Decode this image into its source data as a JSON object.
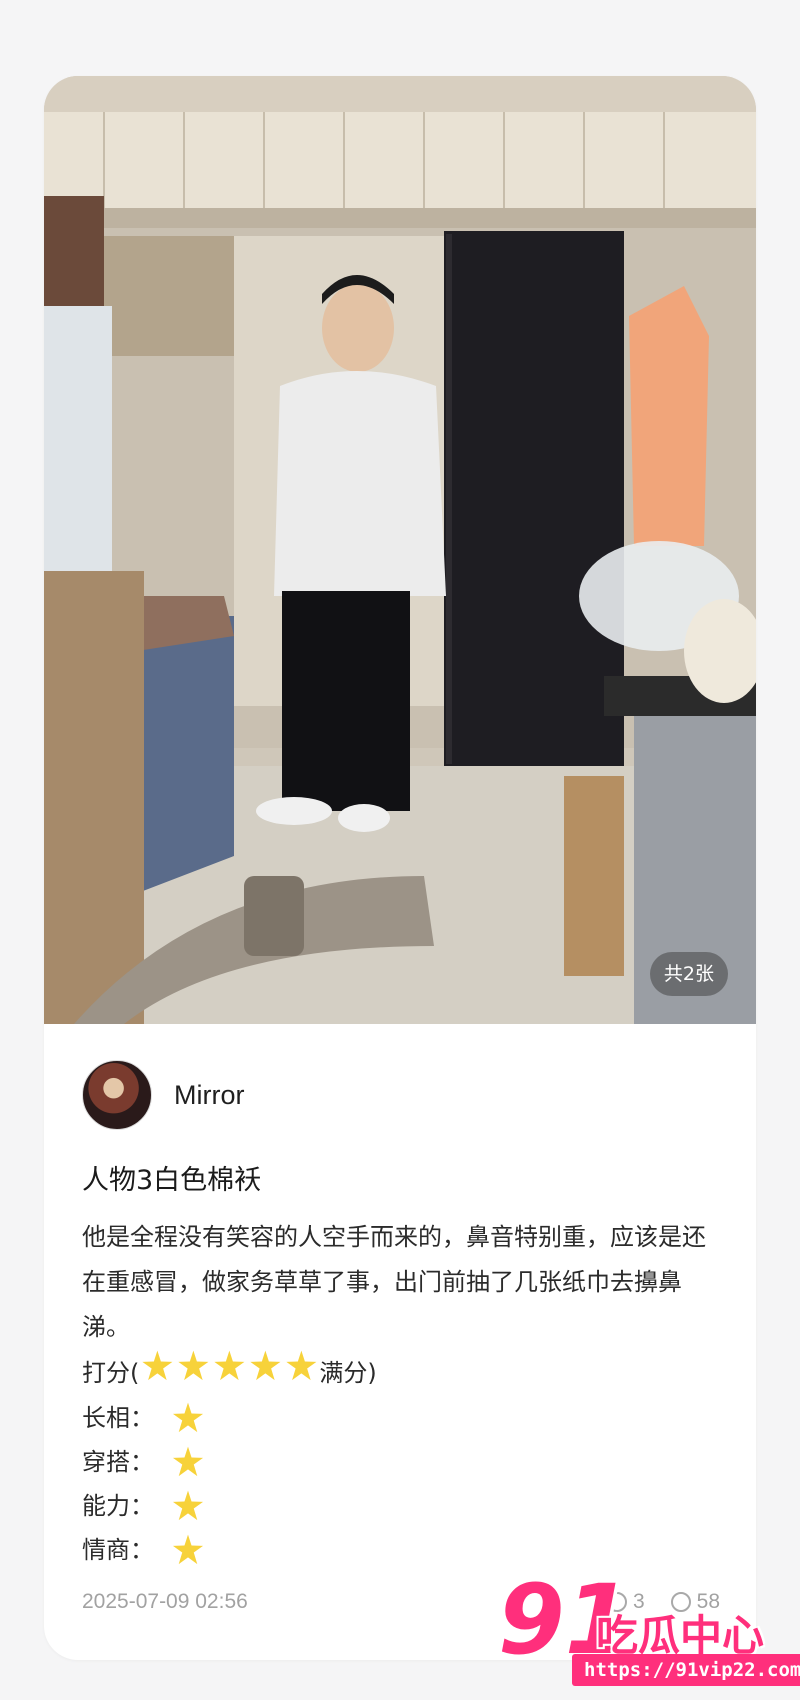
{
  "photo": {
    "alt_subject": "man-in-white-jacket-room-photo",
    "badge": "共2张"
  },
  "post": {
    "author": "Mirror",
    "title": "人物3白色棉袄",
    "body": "他是全程没有笑容的人空手而来的，鼻音特别重，应该是还在重感冒，做家务草草了事，出门前抽了几张纸巾去擤鼻涕。",
    "score": {
      "prefix": "打分(",
      "stars": 5,
      "suffix": "满分)"
    },
    "ratings": [
      {
        "label": "长相：",
        "stars": 1
      },
      {
        "label": "穿搭：",
        "stars": 1
      },
      {
        "label": "能力：",
        "stars": 1
      },
      {
        "label": "情商：",
        "stars": 1
      }
    ],
    "date": "2025-07-09 02:56",
    "likes": "3",
    "comments": "58"
  },
  "watermark": {
    "number": "91",
    "name": "吃瓜中心",
    "url": "https://91vip22.com"
  },
  "colors": {
    "star": "#f7d23a",
    "watermark": "#ff2f7c",
    "meta": "#a2a2a2"
  }
}
